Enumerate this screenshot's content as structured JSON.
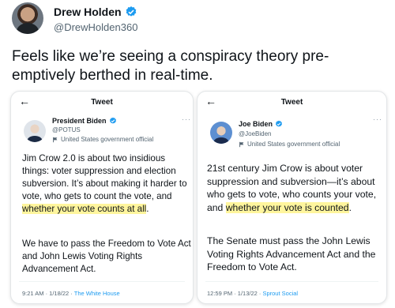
{
  "outer": {
    "name": "Drew Holden",
    "handle": "@DrewHolden360",
    "text": "Feels like we’re seeing a conspiracy theory pre-emptively berthed in real-time."
  },
  "left_card": {
    "header": "Tweet",
    "name": "President Biden",
    "handle": "@POTUS",
    "label": "United States government official",
    "body1_pre": "Jim Crow 2.0 is about two insidious things: voter suppression and election subversion. It’s about making it harder to vote, who gets to count the vote, and ",
    "body1_hl": "whether your vote counts at all",
    "body1_post": ".",
    "body2": "We have to pass the Freedom to Vote Act and John Lewis Voting Rights Advancement Act.",
    "timestamp": "9:21 AM · 1/18/22 · ",
    "source": "The White House"
  },
  "right_card": {
    "header": "Tweet",
    "name": "Joe Biden",
    "handle": "@JoeBiden",
    "label": "United States government official",
    "body1_pre": "21st century Jim Crow is about voter suppression and subversion—it’s about who gets to vote, who counts your vote, and ",
    "body1_hl": "whether your vote is counted",
    "body1_post": ".",
    "body2": "The Senate must pass the John Lewis Voting Rights Advancement Act and the Freedom to Vote Act.",
    "timestamp": "12:59 PM · 1/13/22 · ",
    "source": "Sprout Social"
  },
  "colors": {
    "verified": "#1d9bf0",
    "highlight": "#fff59d",
    "link": "#1d9bf0"
  },
  "icons": {
    "verified": "verified-badge-icon",
    "back": "back-arrow-icon",
    "flag": "government-flag-icon",
    "more": "more-icon"
  }
}
